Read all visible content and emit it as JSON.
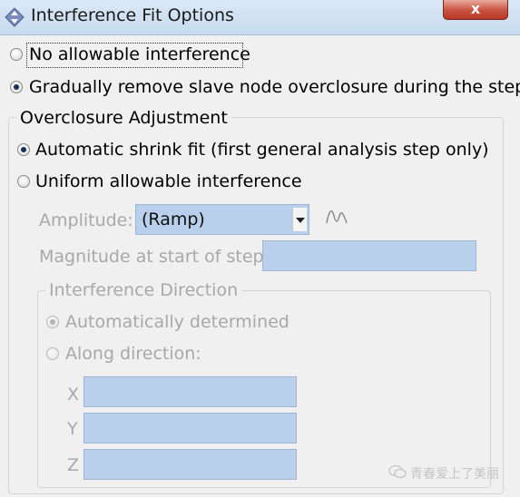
{
  "window": {
    "title": "Interference Fit Options",
    "close_label": "x"
  },
  "options": {
    "no_allowable": "No allowable interference",
    "gradually_remove": "Gradually remove slave node overclosure during the step",
    "selected": "gradually_remove"
  },
  "overclosure": {
    "legend": "Overclosure Adjustment",
    "automatic_shrink": "Automatic shrink fit (first general analysis step only)",
    "uniform_allowable": "Uniform allowable interference",
    "selected": "automatic_shrink"
  },
  "amplitude": {
    "label": "Amplitude:",
    "value": "(Ramp)"
  },
  "magnitude": {
    "label": "Magnitude at start of step:",
    "value": ""
  },
  "direction": {
    "legend": "Interference Direction",
    "auto": "Automatically determined",
    "along": "Along direction:",
    "selected": "auto",
    "x_label": "X",
    "y_label": "Y",
    "z_label": "Z",
    "x_value": "",
    "y_value": "",
    "z_value": ""
  },
  "watermark": {
    "text": "青春爱上了美丽"
  },
  "icons": {
    "app": "diamond-arrows-icon",
    "close": "close-icon",
    "amplitude": "wave-icon",
    "watermark": "chat-bubble-icon"
  }
}
